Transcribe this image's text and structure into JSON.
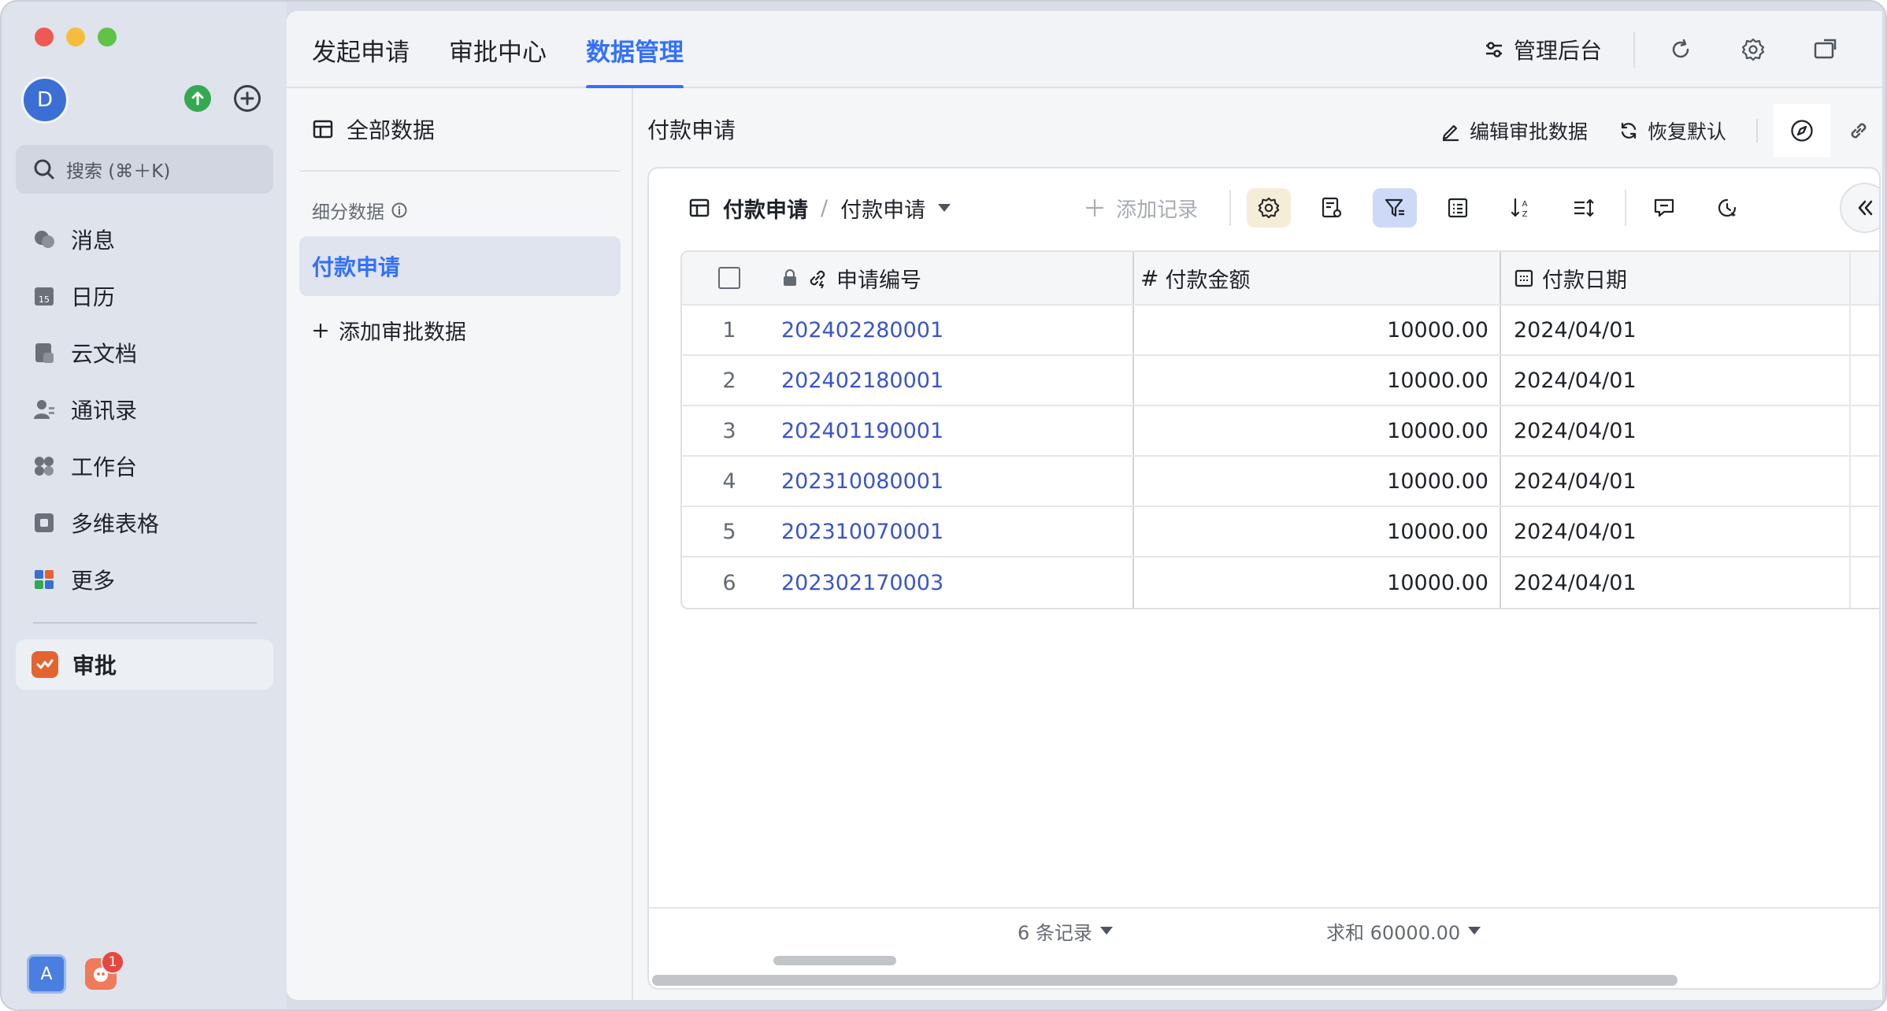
{
  "sidebar": {
    "avatar_letter": "D",
    "search_placeholder": "搜索 (⌘＋K)",
    "items": [
      {
        "label": "消息",
        "icon": "chat-icon"
      },
      {
        "label": "日历",
        "icon": "calendar-icon"
      },
      {
        "label": "云文档",
        "icon": "docs-icon"
      },
      {
        "label": "通讯录",
        "icon": "contacts-icon"
      },
      {
        "label": "工作台",
        "icon": "workplace-icon"
      },
      {
        "label": "多维表格",
        "icon": "base-icon"
      },
      {
        "label": "更多",
        "icon": "more-apps-icon"
      }
    ],
    "active_app": "审批",
    "footer_avatar": "A",
    "notification_count": "1"
  },
  "header": {
    "tabs": [
      "发起申请",
      "审批中心",
      "数据管理"
    ],
    "active_tab": 2,
    "admin_label": "管理后台"
  },
  "panel": {
    "all_data": "全部数据",
    "subsection": "细分数据",
    "selected_item": "付款申请",
    "add_label": "添加审批数据"
  },
  "content": {
    "title": "付款申请",
    "edit_label": "编辑审批数据",
    "restore_label": "恢复默认",
    "table_name": "付款申请",
    "view_name": "付款申请",
    "add_record": "添加记录",
    "columns": [
      "申请编号",
      "付款金额",
      "付款日期"
    ],
    "rows": [
      {
        "idx": "1",
        "no": "202402280001",
        "amount": "10000.00",
        "date": "2024/04/01"
      },
      {
        "idx": "2",
        "no": "202402180001",
        "amount": "10000.00",
        "date": "2024/04/01"
      },
      {
        "idx": "3",
        "no": "202401190001",
        "amount": "10000.00",
        "date": "2024/04/01"
      },
      {
        "idx": "4",
        "no": "202310080001",
        "amount": "10000.00",
        "date": "2024/04/01"
      },
      {
        "idx": "5",
        "no": "202310070001",
        "amount": "10000.00",
        "date": "2024/04/01"
      },
      {
        "idx": "6",
        "no": "202302170003",
        "amount": "10000.00",
        "date": "2024/04/01"
      }
    ],
    "record_count": "6 条记录",
    "sum_label": "求和 60000.00"
  },
  "colors": {
    "accent": "#3370ff",
    "link": "#3a55c8",
    "approve": "#e4642f"
  }
}
